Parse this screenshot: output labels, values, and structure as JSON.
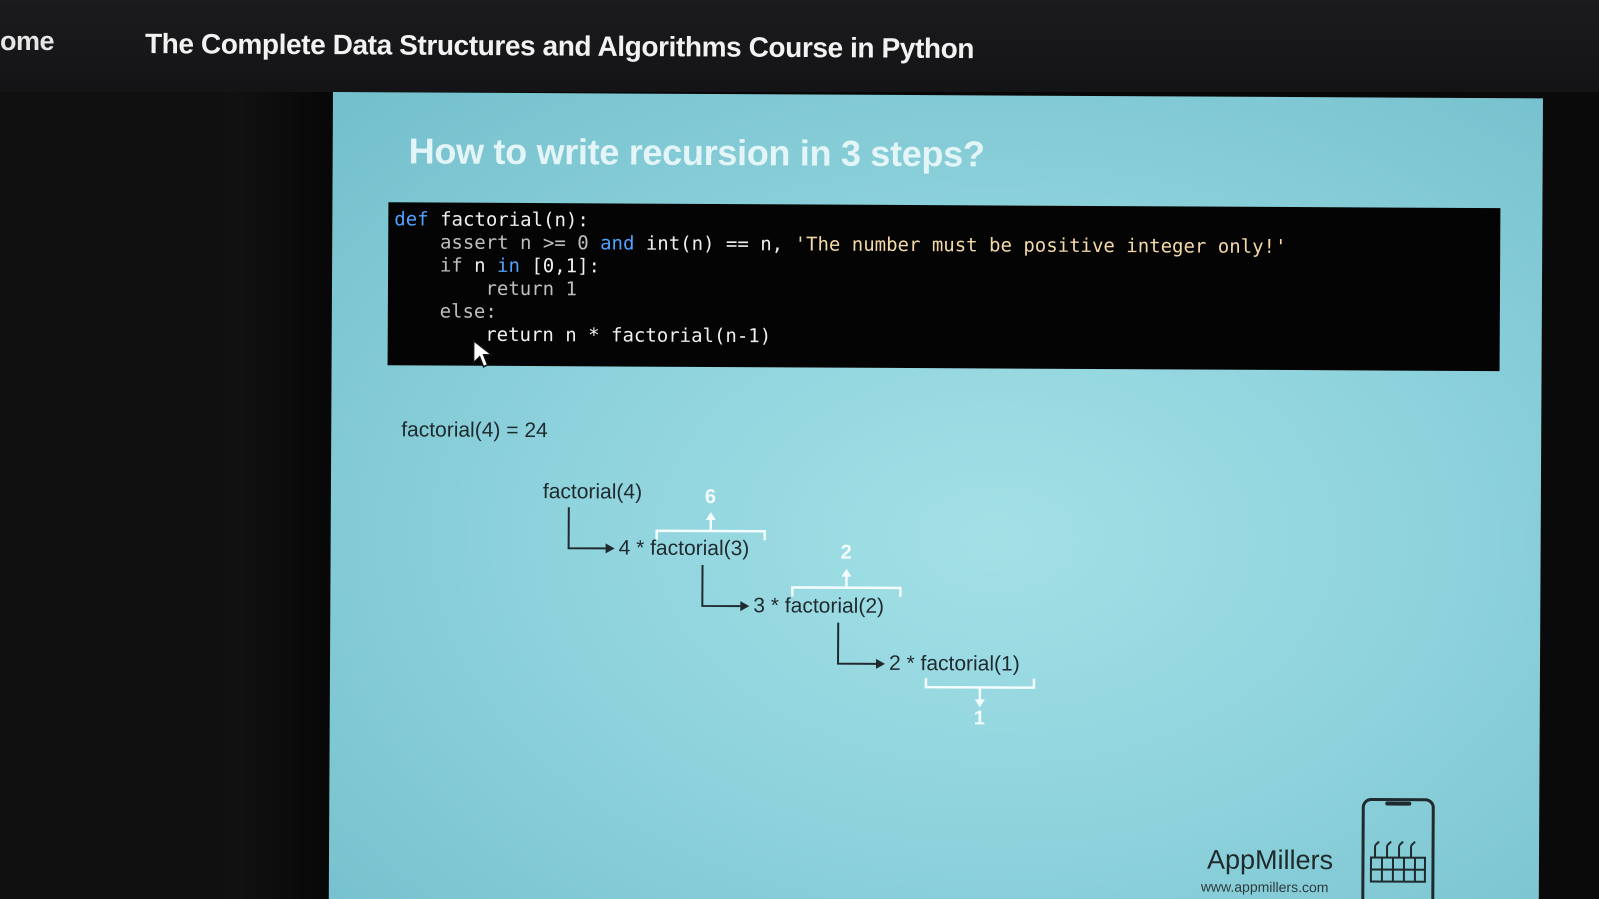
{
  "nav": {
    "home_label": "ome",
    "course_title": "The Complete Data Structures and Algorithms Course in Python"
  },
  "slide": {
    "heading": "How to write recursion in 3 steps?",
    "code": {
      "line1_kw": "def",
      "line1_rest": " factorial(n):",
      "line2_a": "    assert n >= 0 ",
      "line2_and": "and",
      "line2_b": " int(n) == n, ",
      "line2_str": "'The number must be positive integer only!'",
      "line3_if": "    if",
      "line3_a": " n ",
      "line3_in": "in",
      "line3_b": " [0,1]:",
      "line4": "        return 1",
      "line5": "    else:",
      "line6": "        return n * factorial(n-1)"
    },
    "result": "factorial(4) = 24",
    "tree": {
      "root": "factorial(4)",
      "level1": "4 * factorial(3)",
      "level2": "3 * factorial(2)",
      "level3": "2 * factorial(1)",
      "ret_level1": "6",
      "ret_level2": "2",
      "ret_level3": "1"
    },
    "brand": {
      "name": "AppMillers",
      "url": "www.appmillers.com",
      "logo_icon": "factory-phone-icon"
    }
  },
  "colors": {
    "slide_bg": "#8fd3dd",
    "code_bg": "#040404",
    "keyword": "#4fa3ff",
    "string": "#f4d9a8"
  }
}
